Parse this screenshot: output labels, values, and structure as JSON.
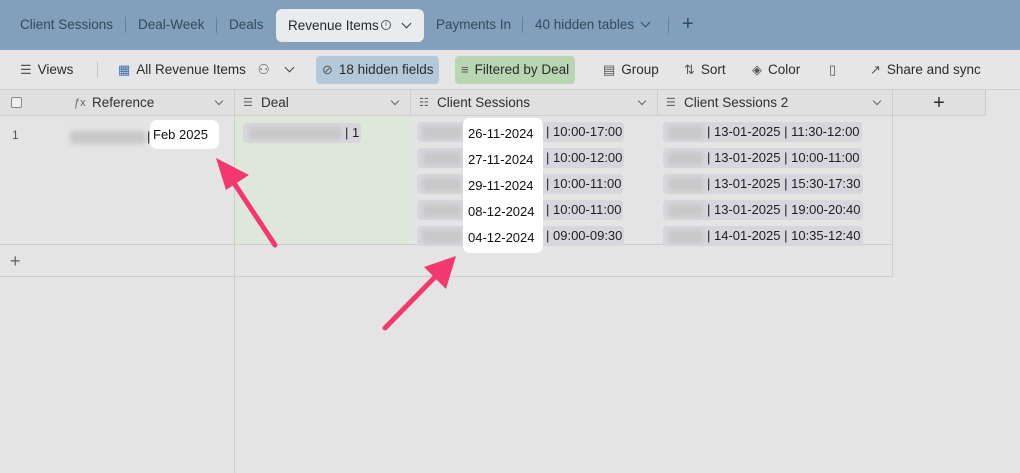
{
  "tabs": {
    "items": [
      {
        "label": "Client Sessions"
      },
      {
        "label": "Deal-Week"
      },
      {
        "label": "Deals"
      },
      {
        "label": "Revenue Items"
      },
      {
        "label": "Payments In"
      },
      {
        "label": "40 hidden tables"
      }
    ],
    "add_label": "+"
  },
  "toolbar": {
    "views": "Views",
    "view_name": "All Revenue Items",
    "hidden_fields": "18 hidden fields",
    "filter": "Filtered by Deal",
    "group": "Group",
    "sort": "Sort",
    "color": "Color",
    "share": "Share and sync"
  },
  "grid": {
    "columns": [
      {
        "label": "Reference",
        "icon": "formula-icon"
      },
      {
        "label": "Deal",
        "icon": "link-icon"
      },
      {
        "label": "Client Sessions",
        "icon": "lookup-icon"
      },
      {
        "label": "Client Sessions 2",
        "icon": "link-icon"
      }
    ],
    "add_column_label": "+",
    "row": {
      "number": "1",
      "reference_suffix": "Feb 2025",
      "deal_suffix": "1",
      "client_sessions": [
        {
          "date": "26-11-2024",
          "time": "10:00-17:00"
        },
        {
          "date": "27-11-2024",
          "time": "10:00-12:00"
        },
        {
          "date": "29-11-2024",
          "time": "10:00-11:00"
        },
        {
          "date": "08-12-2024",
          "time": "10:00-11:00"
        },
        {
          "date": "04-12-2024",
          "time": "09:00-09:30"
        }
      ],
      "client_sessions_2": [
        {
          "date": "13-01-2025",
          "time": "11:30-12:00"
        },
        {
          "date": "13-01-2025",
          "time": "10:00-11:00"
        },
        {
          "date": "13-01-2025",
          "time": "15:30-17:30"
        },
        {
          "date": "13-01-2025",
          "time": "19:00-20:40"
        },
        {
          "date": "14-01-2025",
          "time": "10:35-12:40"
        }
      ]
    },
    "add_row_label": "+"
  },
  "colors": {
    "tabbar": "#8aa9c6",
    "filter_pill": "#b9d6b3",
    "hidden_pill": "#b3c9da",
    "arrow": "#f2386f"
  }
}
